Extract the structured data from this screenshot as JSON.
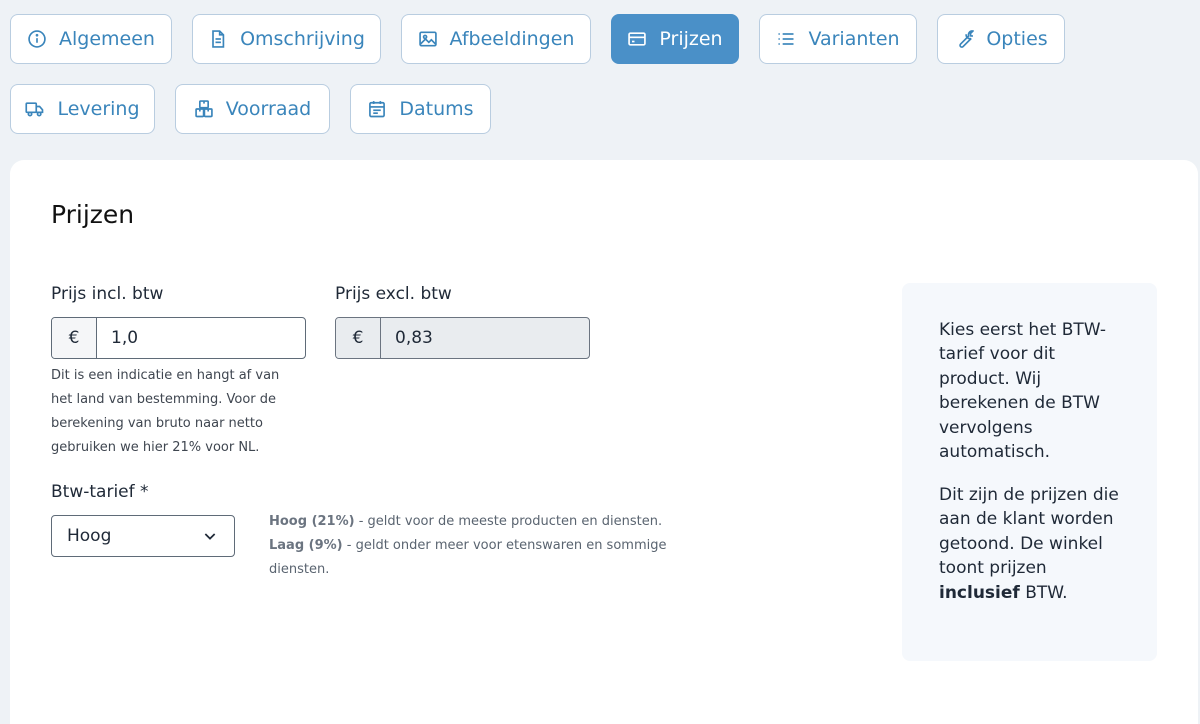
{
  "tabs": [
    {
      "label": "Algemeen",
      "icon": "info-icon"
    },
    {
      "label": "Omschrijving",
      "icon": "document-icon"
    },
    {
      "label": "Afbeeldingen",
      "icon": "image-icon"
    },
    {
      "label": "Prijzen",
      "icon": "credit-card-icon",
      "active": true
    },
    {
      "label": "Varianten",
      "icon": "list-icon"
    },
    {
      "label": "Opties",
      "icon": "wrench-icon"
    },
    {
      "label": "Levering",
      "icon": "truck-icon"
    },
    {
      "label": "Voorraad",
      "icon": "boxes-icon"
    },
    {
      "label": "Datums",
      "icon": "calendar-icon"
    }
  ],
  "section": {
    "title": "Prijzen"
  },
  "price_incl": {
    "label": "Prijs incl. btw",
    "prefix": "€",
    "value": "1,0"
  },
  "price_excl": {
    "label": "Prijs excl. btw",
    "prefix": "€",
    "value": "0,83"
  },
  "help_lines": [
    "Dit is een indicatie en hangt af van",
    "het land van bestemming. Voor de",
    "berekening van bruto naar netto",
    "gebruiken we hier 21% voor NL."
  ],
  "vat": {
    "label": "Btw-tarief *",
    "selected": "Hoog",
    "hoog_term": "Hoog (21%)",
    "hoog_desc": " - geldt voor de meeste producten en diensten.",
    "laag_term": "Laag (9%)",
    "laag_desc": " - geldt onder meer voor etenswaren en sommige",
    "laag_desc_cont": "diensten."
  },
  "aside": {
    "p1_lines": [
      "Kies eerst het BTW-",
      "tarief voor dit",
      "product. Wij",
      "berekenen de BTW",
      "vervolgens",
      "automatisch."
    ],
    "p2_lines": [
      "Dit zijn de prijzen die",
      "aan de klant worden",
      "getoond. De winkel",
      "toont prijzen"
    ],
    "p2_bold": "inclusief",
    "p2_tail": " BTW."
  },
  "colors": {
    "accent": "#4a90c8",
    "tab_text": "#3a85bb",
    "page_bg": "#eef2f6"
  }
}
